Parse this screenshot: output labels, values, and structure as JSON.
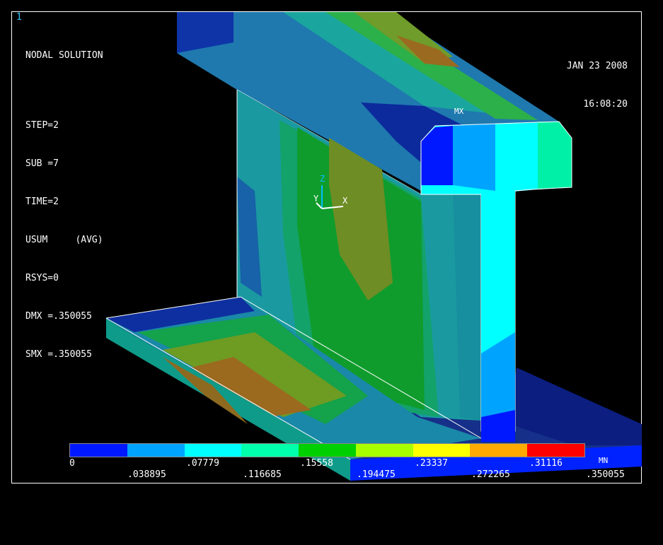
{
  "window_number": "1",
  "title": "NODAL SOLUTION",
  "info_lines": [
    "STEP=2",
    "SUB =7",
    "TIME=2",
    "USUM     (AVG)",
    "RSYS=0",
    "DMX =.350055",
    "SMX =.350055"
  ],
  "date": "JAN 23 2008",
  "time": "16:08:20",
  "markers": {
    "max": "MX",
    "min": "MN"
  },
  "axes": {
    "z": "Z",
    "y": "Y",
    "x": "X"
  },
  "legend": {
    "colors": [
      "#0018ff",
      "#00a4ff",
      "#00ffff",
      "#00ffaa",
      "#00d000",
      "#a8ff00",
      "#ffff00",
      "#ffaa00",
      "#ff0000"
    ],
    "ticks_top": [
      "0",
      ".07779",
      ".15558",
      ".23337",
      ".31116"
    ],
    "ticks_bottom": [
      ".038895",
      ".116685",
      ".194475",
      ".272265",
      ".350055"
    ]
  }
}
